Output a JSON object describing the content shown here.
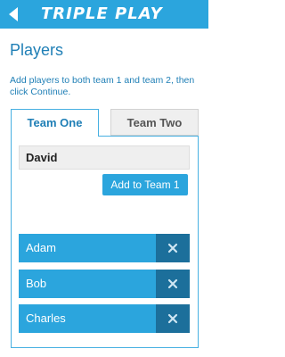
{
  "app": {
    "title": "TRIPLE PLAY"
  },
  "page": {
    "title": "Players",
    "instructions": "Add players to both team 1 and team 2, then click Continue."
  },
  "tabs": [
    {
      "label": "Team One",
      "active": true
    },
    {
      "label": "Team Two",
      "active": false
    }
  ],
  "input": {
    "value": "David"
  },
  "add_button": {
    "label": "Add to Team 1"
  },
  "players": [
    {
      "name": "Adam"
    },
    {
      "name": "Bob"
    },
    {
      "name": "Charles"
    }
  ],
  "icons": {
    "back": "back-arrow-icon",
    "remove": "close-icon"
  },
  "colors": {
    "accent": "#2ba5dd",
    "dark_accent": "#1c6f9b",
    "text_blue": "#1f7fb6"
  }
}
